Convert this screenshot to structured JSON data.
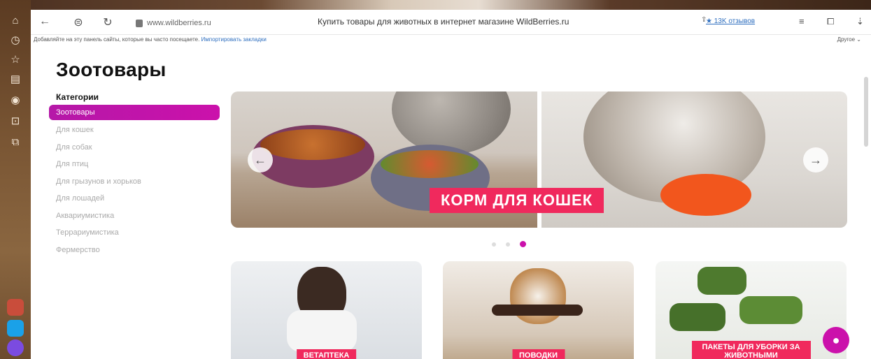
{
  "browser": {
    "url": "www.wildberries.ru",
    "page_title": "Купить товары для животных в интернет магазине WildBerries.ru",
    "reviews": "★ 13K отзывов",
    "bookmark_tip": "Добавляйте на эту панель сайты, которые вы часто посещаете.",
    "bookmark_import": "Импортировать закладки",
    "other_bookmarks": "Другое"
  },
  "page": {
    "heading": "Зоотовары",
    "categories_caption": "Категории",
    "categories": [
      "Зоотовары",
      "Для кошек",
      "Для собак",
      "Для птиц",
      "Для грызунов и хорьков",
      "Для лошадей",
      "Аквариумистика",
      "Террариумистика",
      "Фермерство"
    ],
    "active_category": 0
  },
  "banner": {
    "promo": "КОРМ ДЛЯ КОШЕК",
    "slides": 3,
    "active_slide": 3
  },
  "tiles": [
    {
      "label": "ВЕТАПТЕКА"
    },
    {
      "label": "ПОВОДКИ"
    },
    {
      "label": "ПАКЕТЫ ДЛЯ УБОРКИ ЗА ЖИВОТНЫМИ"
    }
  ],
  "colors": {
    "accent": "#cb11ab",
    "promo": "#f0295d"
  },
  "icons": {
    "back": "arrow-left-icon",
    "forward": "arrow-right-icon",
    "chat": "chat-icon"
  }
}
